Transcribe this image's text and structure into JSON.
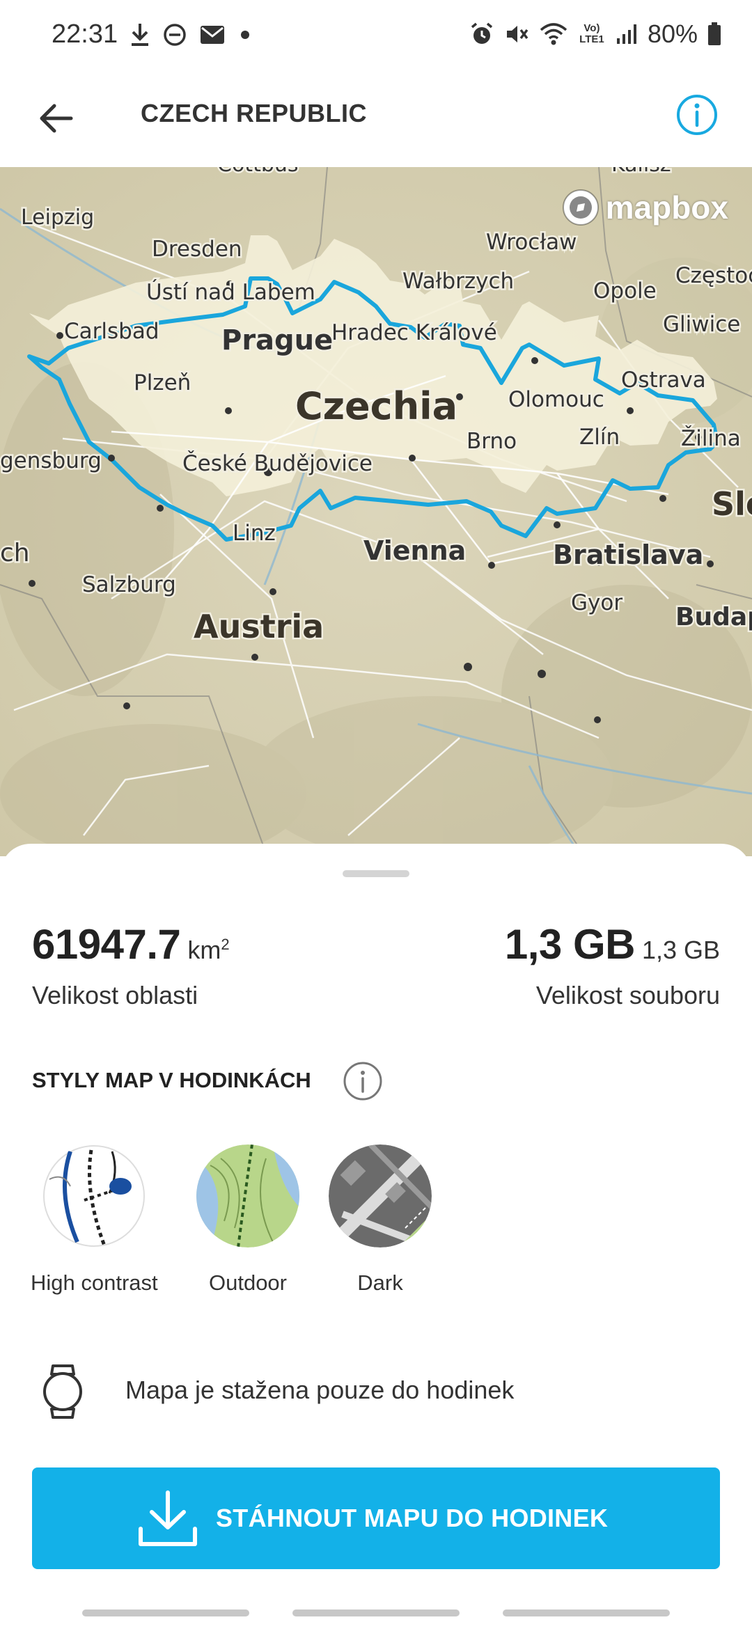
{
  "status_bar": {
    "time": "22:31",
    "battery_percent": "80%",
    "left_icons": [
      "download-icon",
      "do-not-disturb-icon",
      "mail-icon",
      "dot-icon"
    ],
    "right_icons": [
      "alarm-icon",
      "mute-icon",
      "wifi-icon",
      "volte-icon",
      "signal-icon",
      "battery-icon"
    ],
    "volte_label": "Vo) LTE1"
  },
  "header": {
    "title": "CZECH REPUBLIC",
    "back_icon": "arrow-left-icon",
    "info_icon": "info-icon",
    "accent_color": "#18a9e0"
  },
  "map": {
    "attribution": "mapbox",
    "region_label": "Czechia",
    "outline_color": "#1aa6dc",
    "places": [
      "Cottbus",
      "Kalisz",
      "Leipzig",
      "Dresden",
      "Wrocław",
      "Wałbrzych",
      "Częstochowa",
      "Opole",
      "Ústí nad Labem",
      "Carlsbad",
      "Prague",
      "Hradec Králové",
      "Gliwice",
      "Plzeň",
      "Ostrava",
      "Olomouc",
      "Brno",
      "Zlín",
      "Žilina",
      "Regensburg",
      "České Budějovice",
      "Linz",
      "Vienna",
      "Bratislava",
      "Munich",
      "Salzburg",
      "Gyor",
      "Austria",
      "Slovakia",
      "Budapest"
    ],
    "visible_labels": {
      "cottbus": "Cottbus",
      "kalisz": "Kalisz",
      "leipzig": "Leipzig",
      "dresden": "Dresden",
      "wroclaw": "Wrocław",
      "walbrzych": "Wałbrzych",
      "czestochowa": "Częstoc",
      "opole": "Opole",
      "usti": "Ústí nad Labem",
      "carlsbad": "Carlsbad",
      "prague": "Prague",
      "hradec": "Hradec Králové",
      "gliwice": "Gliwice",
      "plzen": "Plzeň",
      "ostrava": "Ostrava",
      "olomouc": "Olomouc",
      "brno": "Brno",
      "zlin": "Zlín",
      "zilina": "Žilina",
      "regensburg": "gensburg",
      "budejovice": "České Budějovice",
      "linz": "Linz",
      "vienna": "Vienna",
      "bratislava": "Bratislava",
      "munich": "ch",
      "salzburg": "Salzburg",
      "gyor": "Gyor",
      "austria": "Austria",
      "slovakia": "Slo",
      "budapest": "Budap",
      "czechia": "Czechia"
    }
  },
  "sheet": {
    "area_value": "61947.7",
    "area_unit": "km",
    "area_unit_sup": "2",
    "area_label": "Velikost oblasti",
    "file_value": "1,3 GB",
    "file_value_small": "1,3 GB",
    "file_label": "Velikost souboru",
    "styles_heading": "STYLY MAP V HODINKÁCH",
    "styles_info_icon": "info-icon",
    "styles": [
      {
        "label": "High contrast",
        "icon": "high-contrast-map-icon"
      },
      {
        "label": "Outdoor",
        "icon": "outdoor-map-icon"
      },
      {
        "label": "Dark",
        "icon": "dark-map-icon"
      }
    ],
    "watch_note": "Mapa je stažena pouze do hodinek",
    "watch_icon": "watch-icon",
    "download_button": "STÁHNOUT MAPU DO HODINEK",
    "download_icon": "download-icon",
    "button_color": "#13b1e8"
  }
}
